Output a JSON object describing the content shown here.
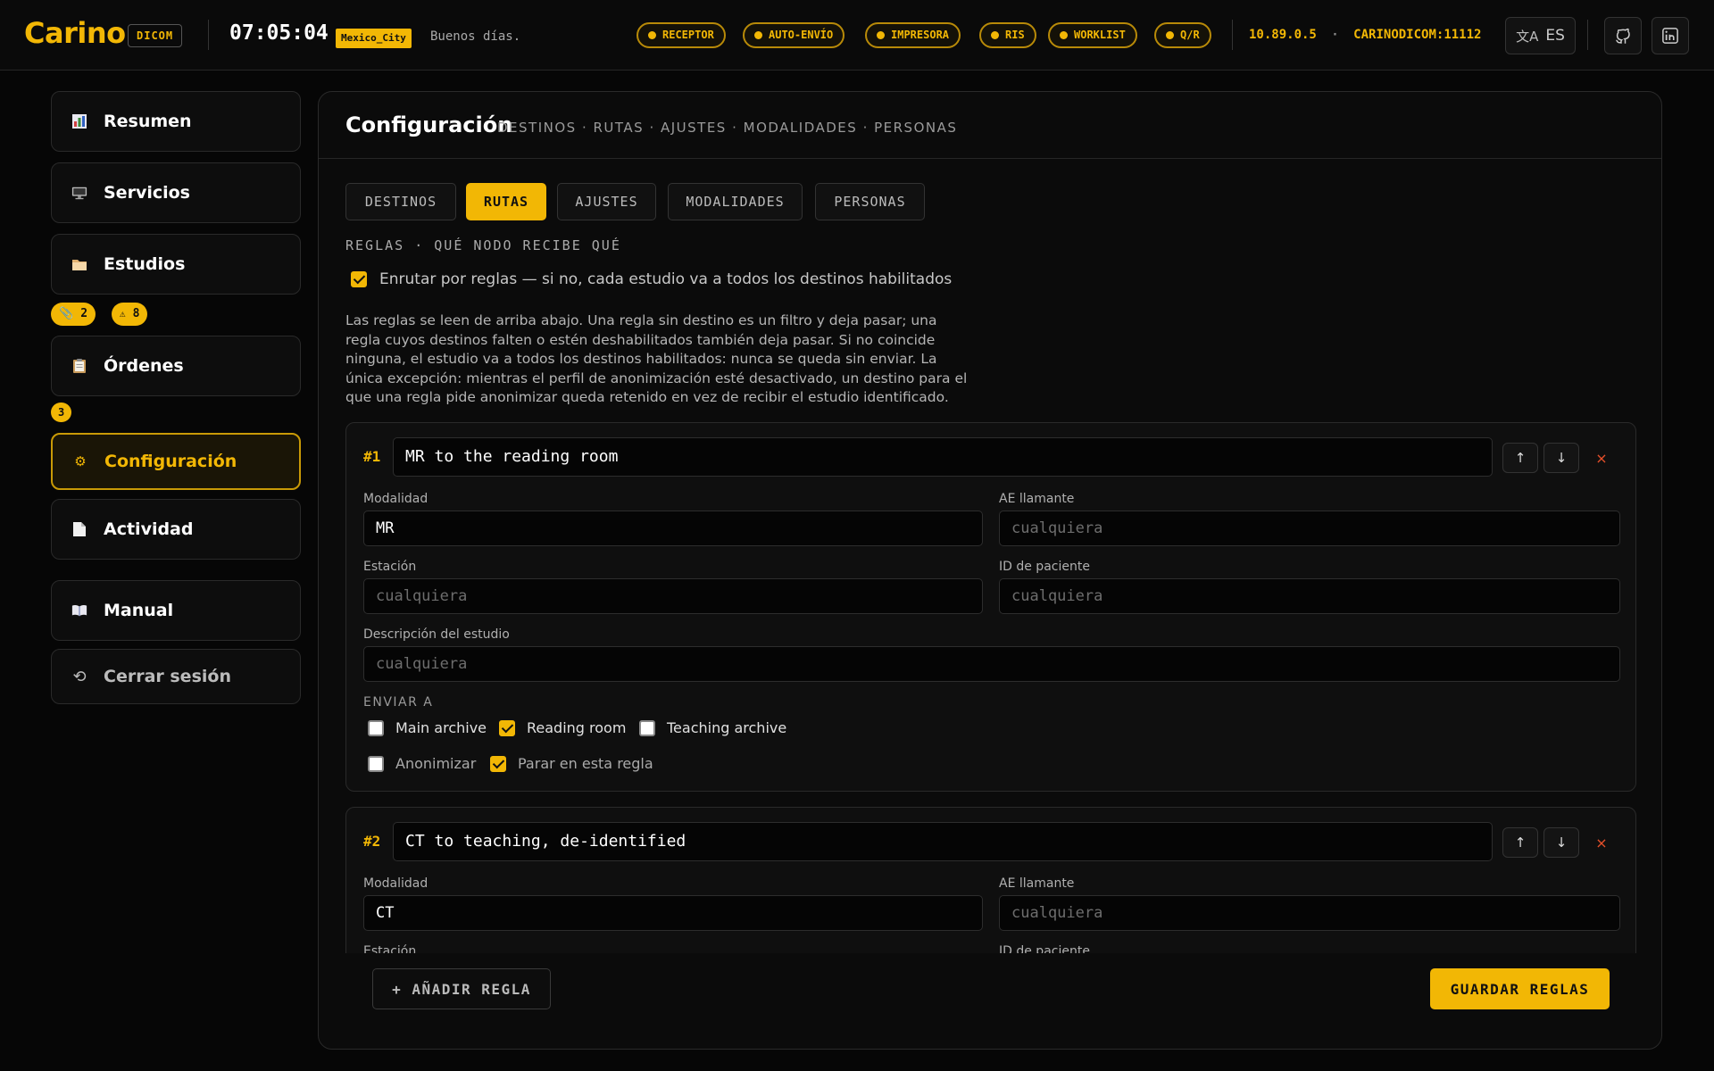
{
  "app": {
    "logo": "Carino",
    "tag": "DICOM",
    "clock": "07:05:04",
    "timezone": "Mexico_City",
    "greeting": "Buenos días."
  },
  "status_pills": [
    "RECEPTOR",
    "AUTO-ENVÍO",
    "IMPRESORA",
    "RIS",
    "WORKLIST",
    "Q/R"
  ],
  "server": {
    "ip": "10.89.0.5",
    "separator": "·",
    "ae_port": "CARINODICOM:11112"
  },
  "lang": "ES",
  "sidebar": {
    "items": [
      {
        "label": "Resumen",
        "icon": "chart-icon"
      },
      {
        "label": "Servicios",
        "icon": "monitor-icon"
      },
      {
        "label": "Estudios",
        "icon": "folder-icon"
      },
      {
        "label": "Órdenes",
        "icon": "clipboard-icon"
      },
      {
        "label": "Configuración",
        "icon": "gear-icon"
      },
      {
        "label": "Actividad",
        "icon": "document-icon"
      },
      {
        "label": "Manual",
        "icon": "book-icon"
      },
      {
        "label": "Cerrar sesión",
        "icon": "logout-icon"
      }
    ],
    "estudios_badges": {
      "attach": "2",
      "warning": "8"
    },
    "ordenes_badge": "3"
  },
  "panel": {
    "title": "Configuración",
    "crumbs": "DESTINOS · RUTAS · AJUSTES · MODALIDADES · PERSONAS",
    "tabs": [
      "DESTINOS",
      "RUTAS",
      "AJUSTES",
      "MODALIDADES",
      "PERSONAS"
    ],
    "active_tab": "RUTAS",
    "section_label": "REGLAS · QUÉ NODO RECIBE QUÉ",
    "routing_toggle": {
      "label": "Enrutar por reglas — si no, cada estudio va a todos los destinos habilitados",
      "checked": true
    },
    "help": "Las reglas se leen de arriba abajo. Una regla sin destino es un filtro y deja pasar; una regla cuyos destinos falten o estén deshabilitados también deja pasar. Si no coincide ninguna, el estudio va a todos los destinos habilitados: nunca se queda sin enviar. La única excepción: mientras el perfil de anonimización esté desactivado, un destino para el que una regla pide anonimizar queda retenido en vez de recibir el estudio identificado."
  },
  "field_labels": {
    "modality": "Modalidad",
    "calling_ae": "AE llamante",
    "station": "Estación",
    "patient_id": "ID de paciente",
    "study_desc": "Descripción del estudio",
    "send_to": "ENVIAR A",
    "placeholder": "cualquiera"
  },
  "rules": [
    {
      "num": "#1",
      "name": "MR to the reading room",
      "modality": "MR",
      "destinations": [
        {
          "label": "Main archive",
          "checked": false
        },
        {
          "label": "Reading room",
          "checked": true
        },
        {
          "label": "Teaching archive",
          "checked": false
        }
      ],
      "anonymize": {
        "label": "Anonimizar",
        "checked": false
      },
      "stop": {
        "label": "Parar en esta regla",
        "checked": true
      }
    },
    {
      "num": "#2",
      "name": "CT to teaching, de-identified",
      "modality": "CT"
    }
  ],
  "buttons": {
    "add_rule": "+ AÑADIR REGLA",
    "save_rules": "GUARDAR REGLAS",
    "up": "↑",
    "down": "↓",
    "delete": "×"
  },
  "colors": {
    "accent": "#f2b705",
    "danger": "#e8502a",
    "bg": "#060606"
  }
}
